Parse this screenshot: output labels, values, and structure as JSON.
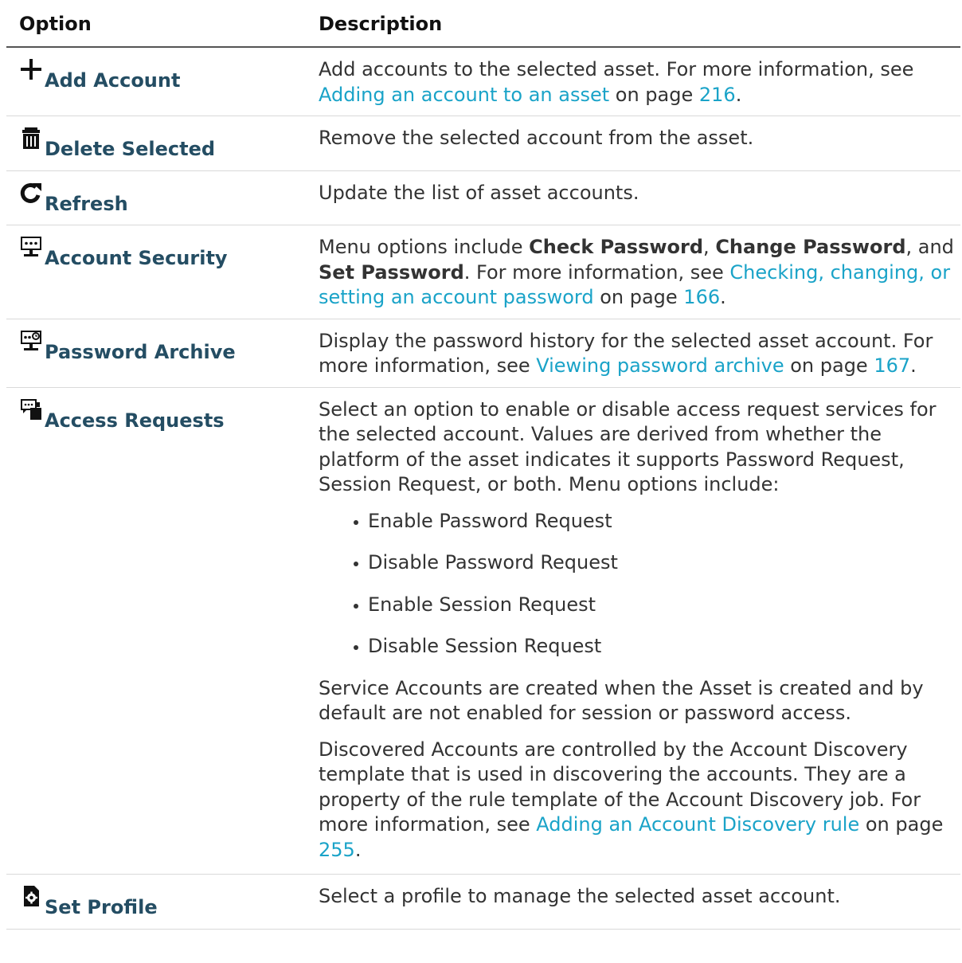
{
  "header": {
    "option": "Option",
    "description": "Description"
  },
  "rows": [
    {
      "icon": "plus-icon",
      "label": "Add Account",
      "desc": [
        {
          "t": "Add accounts to the selected asset. For more information, see "
        },
        {
          "t": "Adding an account to an asset",
          "link": true
        },
        {
          "t": " on page "
        },
        {
          "t": "216",
          "link": true
        },
        {
          "t": "."
        }
      ]
    },
    {
      "icon": "trash-icon",
      "label": "Delete Selected",
      "desc": [
        {
          "t": "Remove the selected account from the asset."
        }
      ]
    },
    {
      "icon": "refresh-icon",
      "label": "Refresh",
      "desc": [
        {
          "t": "Update the list of asset accounts."
        }
      ]
    },
    {
      "icon": "account-security-icon",
      "label": "Account Security",
      "desc": [
        {
          "t": "Menu options include "
        },
        {
          "t": "Check Password",
          "bold": true
        },
        {
          "t": ", "
        },
        {
          "t": "Change Password",
          "bold": true
        },
        {
          "t": ", and "
        },
        {
          "t": "Set Password",
          "bold": true
        },
        {
          "t": ". For more information, see "
        },
        {
          "t": "Checking, changing, or setting an account password",
          "link": true
        },
        {
          "t": " on page "
        },
        {
          "t": "166",
          "link": true
        },
        {
          "t": "."
        }
      ]
    },
    {
      "icon": "password-archive-icon",
      "label": "Password Archive",
      "desc": [
        {
          "t": "Display the password history for the selected asset account. For more information, see "
        },
        {
          "t": "Viewing password archive",
          "link": true
        },
        {
          "t": " on page "
        },
        {
          "t": "167",
          "link": true
        },
        {
          "t": "."
        }
      ]
    },
    {
      "icon": "access-requests-icon",
      "label": "Access Requests",
      "desc": [
        {
          "t": "Select an option to enable or disable access request services for the selected account. Values are derived from whether the platform of the asset indicates it supports Password Request, Session Request, or both. Menu options include:"
        }
      ],
      "menu": [
        "Enable Password Request",
        "Disable Password Request",
        "Enable Session Request",
        "Disable Session Request"
      ],
      "paras": [
        [
          {
            "t": "Service Accounts are created when the Asset is created and by default are not enabled for session or password access."
          }
        ],
        [
          {
            "t": "Discovered Accounts are controlled by the Account Discovery template that is used in discovering the accounts. They are a property of the rule template of the Account Discovery job. For more information, see "
          },
          {
            "t": "Adding an Account Discovery rule",
            "link": true
          },
          {
            "t": " on page "
          },
          {
            "t": "255",
            "link": true
          },
          {
            "t": "."
          }
        ]
      ]
    },
    {
      "icon": "set-profile-icon",
      "label": "Set Profile",
      "desc": [
        {
          "t": "Select a profile to manage the selected asset account."
        }
      ]
    }
  ]
}
